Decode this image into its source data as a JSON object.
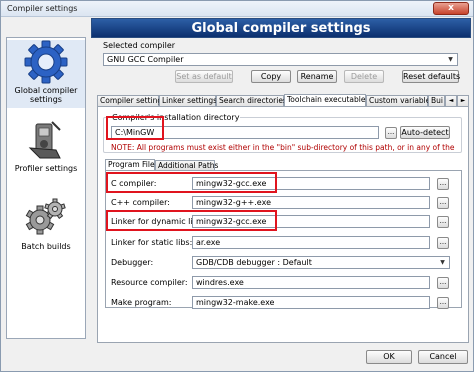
{
  "window": {
    "title": "Compiler settings",
    "close_label": "x"
  },
  "header": {
    "title": "Global compiler settings"
  },
  "sidebar": {
    "items": [
      {
        "label_line1": "Global compiler",
        "label_line2": "settings",
        "icon": "gear-icon",
        "selected": true
      },
      {
        "label_line1": "Profiler settings",
        "label_line2": "",
        "icon": "profiler-icon",
        "selected": false
      },
      {
        "label_line1": "Batch builds",
        "label_line2": "",
        "icon": "batch-gears-icon",
        "selected": false
      }
    ]
  },
  "compiler": {
    "label": "Selected compiler",
    "value": "GNU GCC Compiler",
    "buttons": {
      "set_default": "Set as default",
      "copy": "Copy",
      "rename": "Rename",
      "delete": "Delete",
      "reset": "Reset defaults"
    }
  },
  "tabs": [
    "Compiler settings",
    "Linker settings",
    "Search directories",
    "Toolchain executables",
    "Custom variables",
    "Bui"
  ],
  "tab_nav": {
    "left": "◄",
    "right": "►"
  },
  "toolchain": {
    "install_dir_label": "Compiler's installation directory",
    "install_dir_value": "C:\\MinGW",
    "browse": "...",
    "auto_detect": "Auto-detect",
    "note": "NOTE: All programs must exist either in the \"bin\" sub-directory of this path, or in any of the"
  },
  "subtabs": [
    "Program Files",
    "Additional Paths"
  ],
  "programs": [
    {
      "label": "C compiler:",
      "value": "mingw32-gcc.exe",
      "type": "text"
    },
    {
      "label": "C++ compiler:",
      "value": "mingw32-g++.exe",
      "type": "text"
    },
    {
      "label": "Linker for dynamic libs:",
      "value": "mingw32-gcc.exe",
      "type": "text"
    },
    {
      "label": "Linker for static libs:",
      "value": "ar.exe",
      "type": "text"
    },
    {
      "label": "Debugger:",
      "value": "GDB/CDB debugger : Default",
      "type": "select"
    },
    {
      "label": "Resource compiler:",
      "value": "windres.exe",
      "type": "text"
    },
    {
      "label": "Make program:",
      "value": "mingw32-make.exe",
      "type": "text"
    }
  ],
  "footer": {
    "ok": "OK",
    "cancel": "Cancel"
  },
  "colors": {
    "highlight_box": "#e0141e",
    "header_bg": "#0b2f6e",
    "note_text": "#b00000"
  }
}
